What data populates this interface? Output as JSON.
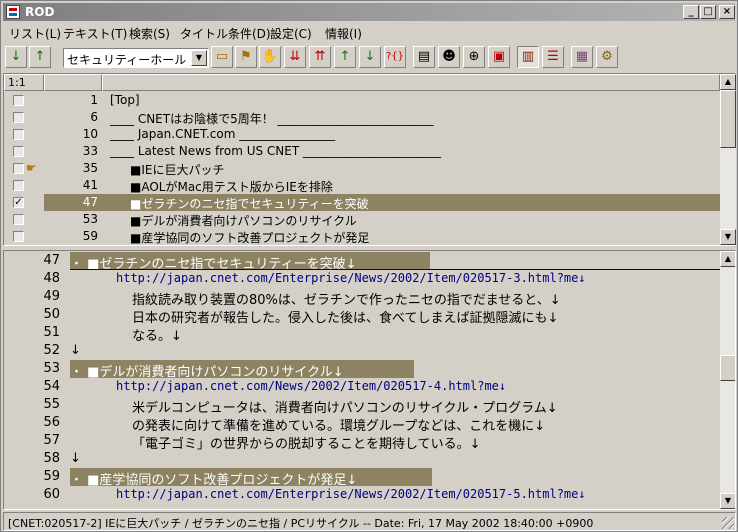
{
  "window": {
    "title": "ROD"
  },
  "menu": [
    "リスト(L)",
    "テキスト(T)",
    "検索(S)",
    "タイトル条件(D)",
    "設定(C)",
    "情報(I)"
  ],
  "toolbar": {
    "combo_value": "セキュリティーホール",
    "buttons": [
      "down-arrow-icon",
      "up-arrow-icon",
      "folder-open-icon",
      "flag-icon",
      "hand-icon",
      "move-down-icon",
      "move-up-icon",
      "arrow-up-green-icon",
      "arrow-down-green-icon",
      "find-icon",
      "book-icon",
      "people-icon",
      "binoculars-icon",
      "clipboard-icon",
      "film-icon",
      "list-icon",
      "print-icon",
      "settings-icon"
    ]
  },
  "list": {
    "header": {
      "col1": "1:1",
      "col2": "",
      "col3": ""
    },
    "rows": [
      {
        "checked": false,
        "mark": "",
        "num": "1",
        "text": "[Top]"
      },
      {
        "checked": false,
        "mark": "",
        "num": "6",
        "text": "____ CNETはお陰様で5周年！ __________________________"
      },
      {
        "checked": false,
        "mark": "",
        "num": "10",
        "text": "____ Japan.CNET.com ________________"
      },
      {
        "checked": false,
        "mark": "",
        "num": "33",
        "text": "____ Latest News from US CNET _______________________"
      },
      {
        "checked": false,
        "mark": "☛",
        "num": "35",
        "text": "■IEに巨大パッチ"
      },
      {
        "checked": false,
        "mark": "",
        "num": "41",
        "text": "■AOLがMac用テスト版からIEを排除"
      },
      {
        "checked": true,
        "mark": "",
        "num": "47",
        "text": "■ゼラチンのニセ指でセキュリティーを突破",
        "selected": true
      },
      {
        "checked": false,
        "mark": "",
        "num": "53",
        "text": "■デルが消費者向けパソコンのリサイクル"
      },
      {
        "checked": false,
        "mark": "",
        "num": "59",
        "text": "■産学協同のソフト改善プロジェクトが発足"
      }
    ]
  },
  "text": {
    "lines": [
      {
        "n": "47",
        "text": "・    ■ゼラチンのニセ指でセキュリティーを突破↓",
        "kind": "heading"
      },
      {
        "n": "48",
        "text": "http://japan.cnet.com/Enterprise/News/2002/Item/020517-3.html?me↓",
        "kind": "url"
      },
      {
        "n": "49",
        "text": "指紋読み取り装置の80%は、ゼラチンで作ったニセの指でだませると、↓",
        "kind": "body"
      },
      {
        "n": "50",
        "text": "日本の研究者が報告した。侵入した後は、食べてしまえば証拠隠滅にも↓",
        "kind": "body"
      },
      {
        "n": "51",
        "text": "なる。↓",
        "kind": "body"
      },
      {
        "n": "52",
        "text": "↓",
        "kind": "blank"
      },
      {
        "n": "53",
        "text": "・    ■デルが消費者向けパソコンのリサイクル↓",
        "kind": "heading"
      },
      {
        "n": "54",
        "text": "http://japan.cnet.com/News/2002/Item/020517-4.html?me↓",
        "kind": "url"
      },
      {
        "n": "55",
        "text": "米デルコンピュータは、消費者向けパソコンのリサイクル・プログラム↓",
        "kind": "body"
      },
      {
        "n": "56",
        "text": "の発表に向けて準備を進めている。環境グループなどは、これを機に↓",
        "kind": "body"
      },
      {
        "n": "57",
        "text": "「電子ゴミ」の世界からの脱却することを期待している。↓",
        "kind": "body"
      },
      {
        "n": "58",
        "text": "↓",
        "kind": "blank"
      },
      {
        "n": "59",
        "text": "・    ■産学協同のソフト改善プロジェクトが発足↓",
        "kind": "heading"
      },
      {
        "n": "60",
        "text": "http://japan.cnet.com/Enterprise/News/2002/Item/020517-5.html?me↓",
        "kind": "url"
      }
    ]
  },
  "status": "[CNET:020517-2] IEに巨大パッチ / ゼラチンのニセ指 / PCリサイクル -- Date: Fri, 17 May 2002 18:40:00 +0900"
}
